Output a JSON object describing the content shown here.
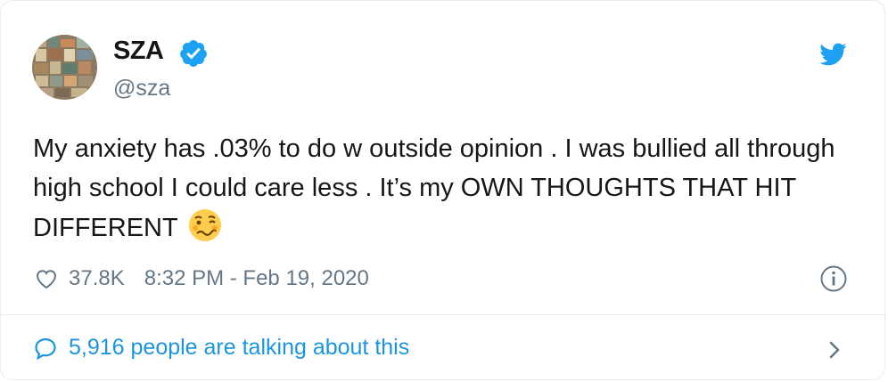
{
  "tweet": {
    "author_name": "SZA",
    "author_handle": "@sza",
    "text": "My anxiety has .03% to do w outside opinion . I was bullied all through high school I could care less . It’s my OWN THOUGHTS THAT HIT DIFFERENT",
    "emoji": "woozy-face",
    "likes": "37.8K",
    "timestamp": "8:32 PM - Feb 19, 2020",
    "talking_label": "5,916 people are talking about this"
  },
  "colors": {
    "brand_blue": "#1da1f2",
    "link_blue": "#1b95e0",
    "secondary_text": "#657786",
    "divider": "#e6ecf0"
  },
  "icons": [
    "verified-badge-icon",
    "twitter-bird-icon",
    "heart-icon",
    "info-icon",
    "reply-bubble-icon",
    "chevron-right-icon"
  ]
}
